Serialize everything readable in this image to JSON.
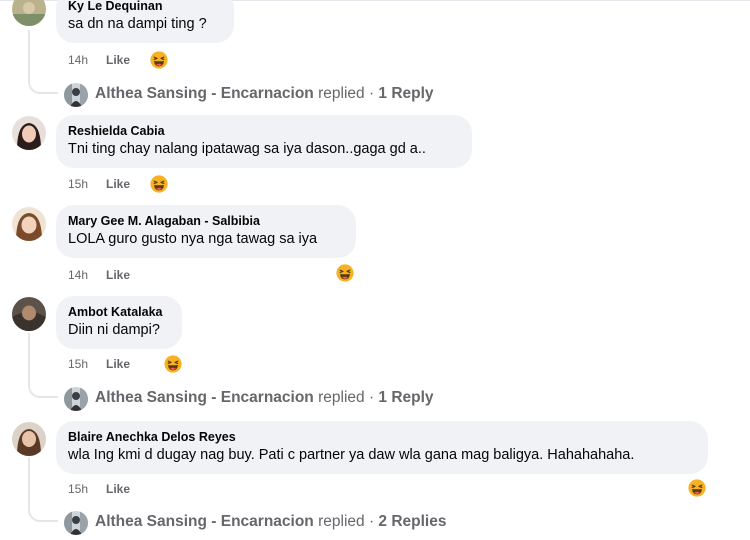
{
  "comments": [
    {
      "author": "Ky Le Dequinan",
      "text": "sa dn na dampi ting ?",
      "time": "14h",
      "like": "Like",
      "reply": {
        "name": "Althea Sansing - Encarnacion",
        "verb": "replied",
        "count": "1 Reply"
      }
    },
    {
      "author": "Reshielda Cabia",
      "text": "Tni ting chay nalang ipatawag sa iya dason..gaga gd a..",
      "time": "15h",
      "like": "Like"
    },
    {
      "author": "Mary Gee M. Alagaban - Salbibia",
      "text": "LOLA guro gusto nya nga tawag sa iya",
      "time": "14h",
      "like": "Like"
    },
    {
      "author": "Ambot Katalaka",
      "text": "Diin ni dampi?",
      "time": "15h",
      "like": "Like",
      "reply": {
        "name": "Althea Sansing - Encarnacion",
        "verb": "replied",
        "count": "1 Reply"
      }
    },
    {
      "author": "Blaire Anechka Delos Reyes",
      "text": "wla Ing kmi d dugay nag buy. Pati c partner ya daw wla gana mag baligya. Hahahahaha.",
      "time": "15h",
      "like": "Like",
      "reply": {
        "name": "Althea Sansing - Encarnacion",
        "verb": "replied",
        "count": "2 Replies"
      }
    }
  ],
  "reaction": {
    "emoji": "laughing-face-icon",
    "color": "#f7b125"
  },
  "colors": {
    "bubble": "#f0f2f5",
    "meta": "#65676b",
    "thread": "#e4e6eb"
  }
}
